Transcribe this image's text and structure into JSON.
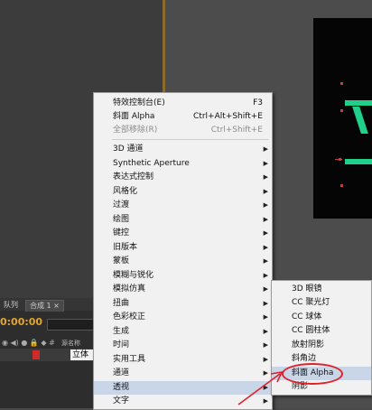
{
  "timeline": {
    "tab_queue": "队列",
    "tab_comp": "合成 1",
    "timecode": "0:00:00",
    "col_source": "源名称",
    "layer_name": "立体"
  },
  "menu": {
    "items": [
      {
        "label": "特效控制台(E)",
        "shortcut": "F3"
      },
      {
        "label": "斜面 Alpha",
        "shortcut": "Ctrl+Alt+Shift+E"
      },
      {
        "label": "全部移除(R)",
        "shortcut": "Ctrl+Shift+E"
      },
      {
        "label": "3D 通道"
      },
      {
        "label": "Synthetic Aperture"
      },
      {
        "label": "表达式控制"
      },
      {
        "label": "风格化"
      },
      {
        "label": "过渡"
      },
      {
        "label": "绘图"
      },
      {
        "label": "键控"
      },
      {
        "label": "旧版本"
      },
      {
        "label": "蒙板"
      },
      {
        "label": "模糊与锐化"
      },
      {
        "label": "模拟仿真"
      },
      {
        "label": "扭曲"
      },
      {
        "label": "色彩校正"
      },
      {
        "label": "生成"
      },
      {
        "label": "时间"
      },
      {
        "label": "实用工具"
      },
      {
        "label": "通道"
      },
      {
        "label": "透视"
      },
      {
        "label": "文字"
      }
    ]
  },
  "submenu": {
    "items": [
      {
        "label": "3D 眼镜"
      },
      {
        "label": "CC 聚光灯"
      },
      {
        "label": "CC 球体"
      },
      {
        "label": "CC 圆柱体"
      },
      {
        "label": "放射阴影"
      },
      {
        "label": "斜角边"
      },
      {
        "label": "斜面 Alpha"
      },
      {
        "label": "阴影"
      }
    ]
  },
  "colors": {
    "menu_bg": "#f1f1f1",
    "highlight": "#c9d6e8",
    "timecode": "#e3a62b",
    "annotation_red": "#e0202a",
    "comp_shape": "#1fd08a"
  }
}
